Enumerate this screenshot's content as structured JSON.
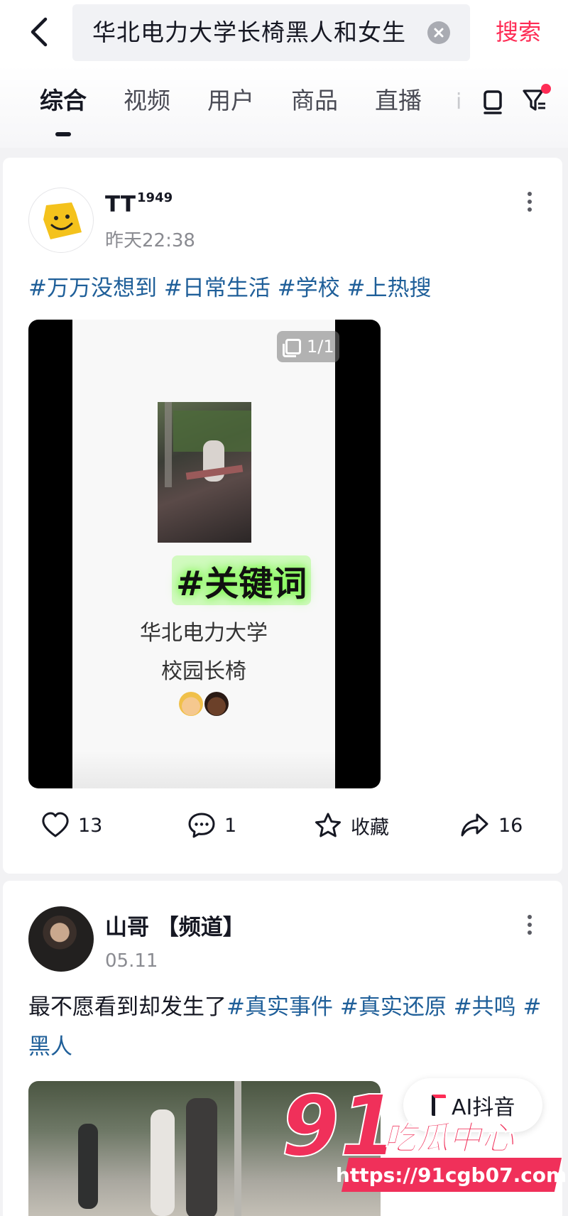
{
  "search": {
    "query": "华北电力大学长椅黑人和女生",
    "submit_label": "搜索"
  },
  "tabs": [
    {
      "label": "综合",
      "active": true
    },
    {
      "label": "视频",
      "active": false
    },
    {
      "label": "用户",
      "active": false
    },
    {
      "label": "商品",
      "active": false
    },
    {
      "label": "直播",
      "active": false
    }
  ],
  "posts": [
    {
      "author": "TT",
      "author_suffix": "1949",
      "time": "昨天22:38",
      "text_segments": [
        {
          "text": "#万万没想到",
          "type": "tag"
        },
        {
          "text": " ",
          "type": "text"
        },
        {
          "text": "#日常生活",
          "type": "tag"
        },
        {
          "text": " ",
          "type": "text"
        },
        {
          "text": "#学校",
          "type": "tag"
        },
        {
          "text": " ",
          "type": "text"
        },
        {
          "text": "#上热搜",
          "type": "tag"
        }
      ],
      "media": {
        "page_indicator": "1/1",
        "overlay_keyword": "#关键词",
        "overlay_line1": "华北电力大学",
        "overlay_line2": "校园长椅"
      },
      "stats": {
        "likes": "13",
        "comments": "1",
        "favorite_label": "收藏",
        "shares": "16"
      }
    },
    {
      "author": "山哥 【频道】",
      "time": "05.11",
      "text_segments": [
        {
          "text": "最不愿看到却发生了",
          "type": "text"
        },
        {
          "text": "#真实事件",
          "type": "tag"
        },
        {
          "text": " ",
          "type": "text"
        },
        {
          "text": "#真实还原",
          "type": "tag"
        },
        {
          "text": " ",
          "type": "text"
        },
        {
          "text": "#共鸣",
          "type": "tag"
        },
        {
          "text": " ",
          "type": "text"
        },
        {
          "text": "#黑人",
          "type": "tag"
        }
      ]
    }
  ],
  "ai_bubble": {
    "label": "AI抖音"
  },
  "watermark": {
    "number": "91",
    "name": "吃瓜中心",
    "url": "https://91cgb07.com"
  },
  "colors": {
    "accent": "#fe2c55",
    "hashtag": "#1f5f99",
    "watermark": "#f0305a"
  },
  "icons": [
    "back-arrow-icon",
    "clear-icon",
    "tablet-icon",
    "filter-icon",
    "more-icon",
    "images-icon",
    "heart-icon",
    "comment-icon",
    "star-icon",
    "share-icon"
  ]
}
